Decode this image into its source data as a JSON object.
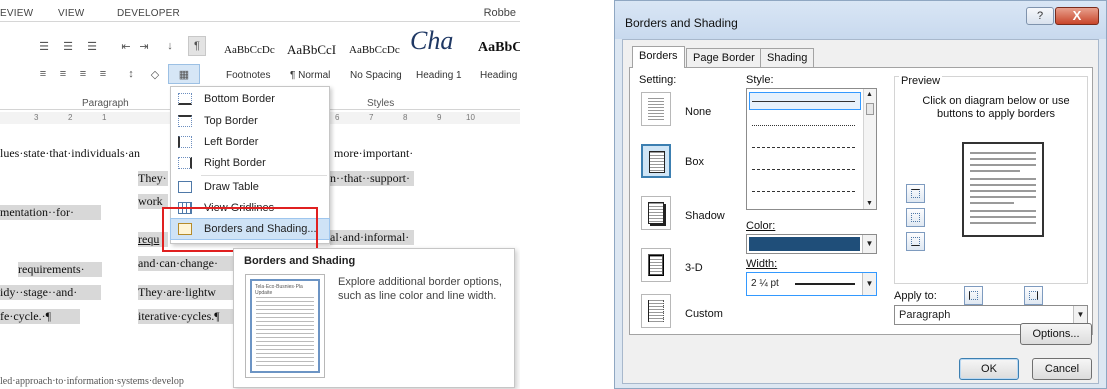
{
  "word": {
    "tabs": [
      "EVIEW",
      "VIEW",
      "DEVELOPER"
    ],
    "user": "Robbe",
    "paragraph_group_label": "Paragraph",
    "styles_group_label": "Styles",
    "styles": [
      {
        "sample": "AaBbCcDc",
        "name": "Footnotes"
      },
      {
        "sample": "AaBbCcI",
        "name": "¶ Normal"
      },
      {
        "sample": "AaBbCcDc",
        "name": "No Spacing"
      },
      {
        "sample": "Cha",
        "name": "Heading 1"
      },
      {
        "sample": "AaBbC",
        "name": "Heading"
      }
    ],
    "ruler_marks": [
      "3",
      "2",
      "1",
      "6",
      "7",
      "8",
      "9",
      "10"
    ],
    "doc_lines": [
      "lues·state·that·individuals·an",
      "more·important·",
      "They·",
      "n··that··support·",
      "work",
      "mentation··for·",
      "requ",
      "al·and·informal·",
      "and·can·change·",
      "requirements·",
      "idy··stage··and·",
      "They·are·lightw",
      "fe·cycle.·¶",
      "iterative·cycles.¶",
      "led·approach·to·information·systems·develop"
    ],
    "menu": [
      {
        "label": "Bottom Border",
        "icon": "bottom-border-icon"
      },
      {
        "label": "Top Border",
        "icon": "top-border-icon"
      },
      {
        "label": "Left Border",
        "icon": "left-border-icon"
      },
      {
        "label": "Right Border",
        "icon": "right-border-icon"
      },
      {
        "label": "Draw Table",
        "icon": "draw-table-icon"
      },
      {
        "label": "View Gridlines",
        "icon": "gridlines-icon"
      },
      {
        "label": "Borders and Shading...",
        "icon": "borders-shading-icon"
      }
    ],
    "tooltip": {
      "title": "Borders and Shading",
      "text": "Explore additional border options, such as line color and line width.",
      "thumb_title": "Tela·Eco·Busnies·Pla Updaite"
    }
  },
  "dialog": {
    "title": "Borders and Shading",
    "help": "?",
    "close": "X",
    "tabs": [
      "Borders",
      "Page Border",
      "Shading"
    ],
    "setting_label": "Setting:",
    "settings": [
      "None",
      "Box",
      "Shadow",
      "3-D",
      "Custom"
    ],
    "selected_setting": "Box",
    "style_label": "Style:",
    "color_label": "Color:",
    "color_value": "#1f4e79",
    "width_label": "Width:",
    "width_value": "2 ¼ pt",
    "preview_label": "Preview",
    "preview_hint": "Click on diagram below or use buttons to apply borders",
    "apply_to_label": "Apply to:",
    "apply_to_value": "Paragraph",
    "options_button": "Options...",
    "ok_button": "OK",
    "cancel_button": "Cancel"
  }
}
